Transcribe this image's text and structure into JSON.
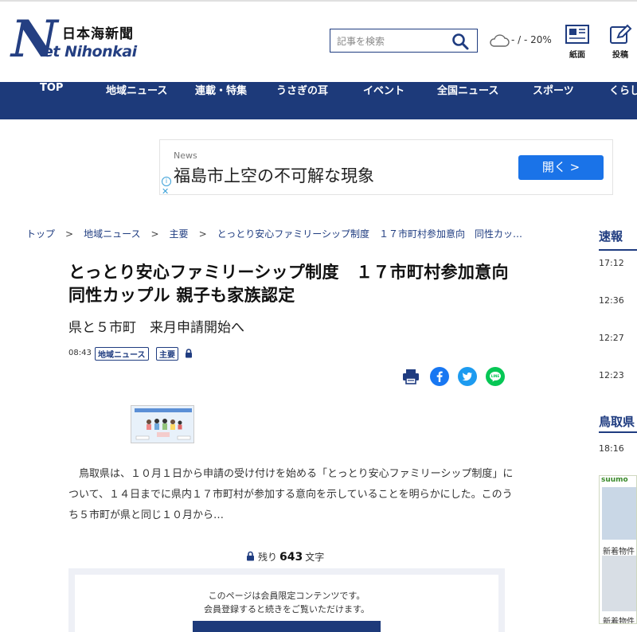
{
  "header": {
    "logo_jp": "日本海新聞",
    "logo_en": "Nihonkai",
    "logo_net": "Net",
    "search_placeholder": "記事を検索",
    "weather": "- / - 20%",
    "icons": [
      {
        "name": "newspaper-icon",
        "label": "紙面"
      },
      {
        "name": "post-icon",
        "label": "投稿"
      }
    ]
  },
  "nav": [
    "TOP",
    "地域ニュース",
    "連載・特集",
    "うさぎの耳",
    "イベント",
    "全国ニュース",
    "スポーツ",
    "くらし"
  ],
  "ad": {
    "small": "News",
    "headline": "福島市上空の不可解な現象",
    "button": "開く  >"
  },
  "breadcrumb": [
    "トップ",
    "地域ニュース",
    "主要",
    "とっとり安心ファミリーシップ制度　１７市町村参加意向　同性カッ…"
  ],
  "article": {
    "title": "とっとり安心ファミリーシップ制度　１７市町村参加意向　同性カップル 親子も家族認定",
    "subtitle": "県と５市町　来月申請開始へ",
    "time": "08:43",
    "tags": [
      "地域ニュース",
      "主要"
    ],
    "body": "　鳥取県は、１０月１日から申請の受け付けを始める「とっとり安心ファミリーシップ制度」について、１４日までに県内１７市町村が参加する意向を示していることを明らかにした。このうち５市町が県と同じ１０月から…",
    "remain_prefix": "残り",
    "remain_num": "643",
    "remain_suffix": "文字",
    "paywall_line1": "このページは会員限定コンテンツです。",
    "paywall_line2": "会員登録すると続きをご覧いただけます。"
  },
  "sidebar": {
    "sokuho": "速報",
    "times": [
      "17:12",
      "12:36",
      "12:27",
      "12:23"
    ],
    "tottori": "鳥取県",
    "tottori_time": "18:16",
    "suumo": "suumo",
    "new_listing": "新着物件"
  }
}
